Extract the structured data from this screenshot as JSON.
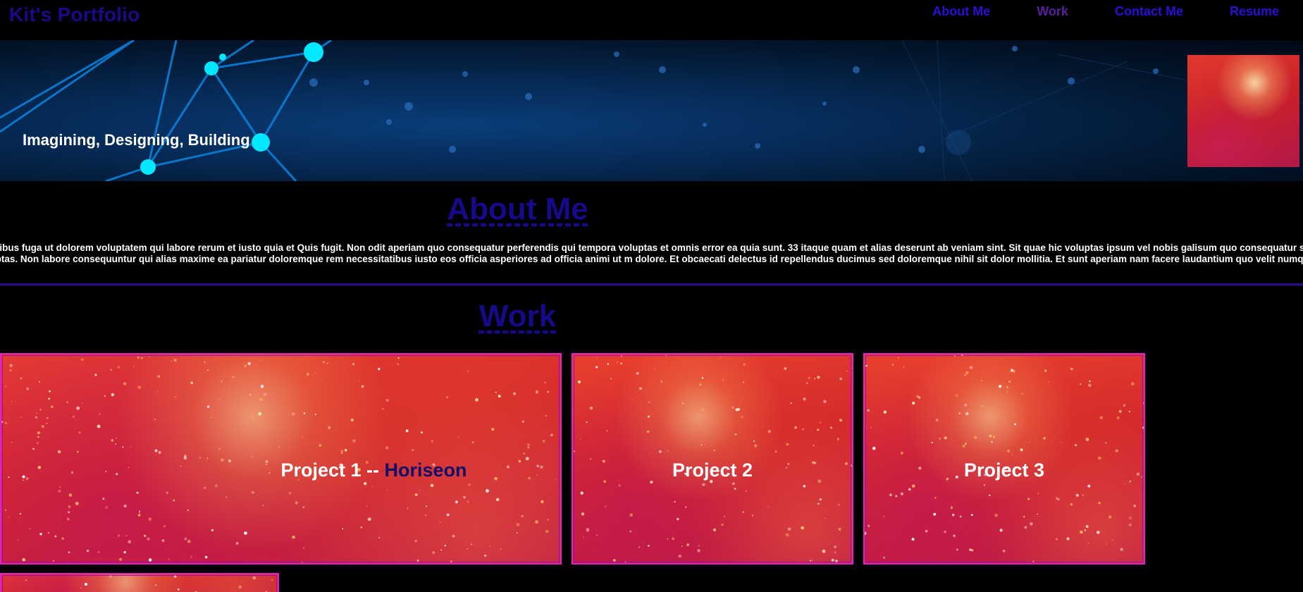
{
  "header": {
    "logo": "Kit's Portfolio",
    "nav": [
      {
        "label": "About Me"
      },
      {
        "label": "Work"
      },
      {
        "label": "Contact Me"
      },
      {
        "label": "Resume"
      }
    ]
  },
  "hero": {
    "tagline": "Imagining, Designing, Building"
  },
  "about": {
    "title": "About Me",
    "body": "Lorem ipsum dolor sit amet. Vel temporibus fuga ut dolorem voluptatem qui labore rerum et iusto quia et Quis fugit. Non odit aperiam quo consequatur perferendis qui tempora voluptas et omnis error ea quia sunt. 33 itaque quam et alias deserunt ab veniam sint. Sit quae hic voluptas ipsum vel nobis galisum quo consequatur sint sit culpa sunt sed blanditiis similique est voluptatibus voluptas. Non labore consequuntur qui alias maxime ea pariatur doloremque rem necessitatibus iusto eos officia asperiores ad officia animi ut m dolore. Et obcaecati delectus id repellendus ducimus sed doloremque nihil sit dolor mollitia. Et sunt aperiam nam facere laudantium quo velit numquam sed aliquam dicta."
  },
  "work": {
    "title": "Work",
    "projects": [
      {
        "label": "Project 1 -- ",
        "link": "Horiseon"
      },
      {
        "label": "Project 2"
      },
      {
        "label": "Project 3"
      }
    ]
  },
  "colors": {
    "background": "#000000",
    "heading": "#160a8a",
    "nav_link": "#2a0fd6",
    "nav_visited": "#5a1fa0",
    "card_border": "#e020c8"
  }
}
